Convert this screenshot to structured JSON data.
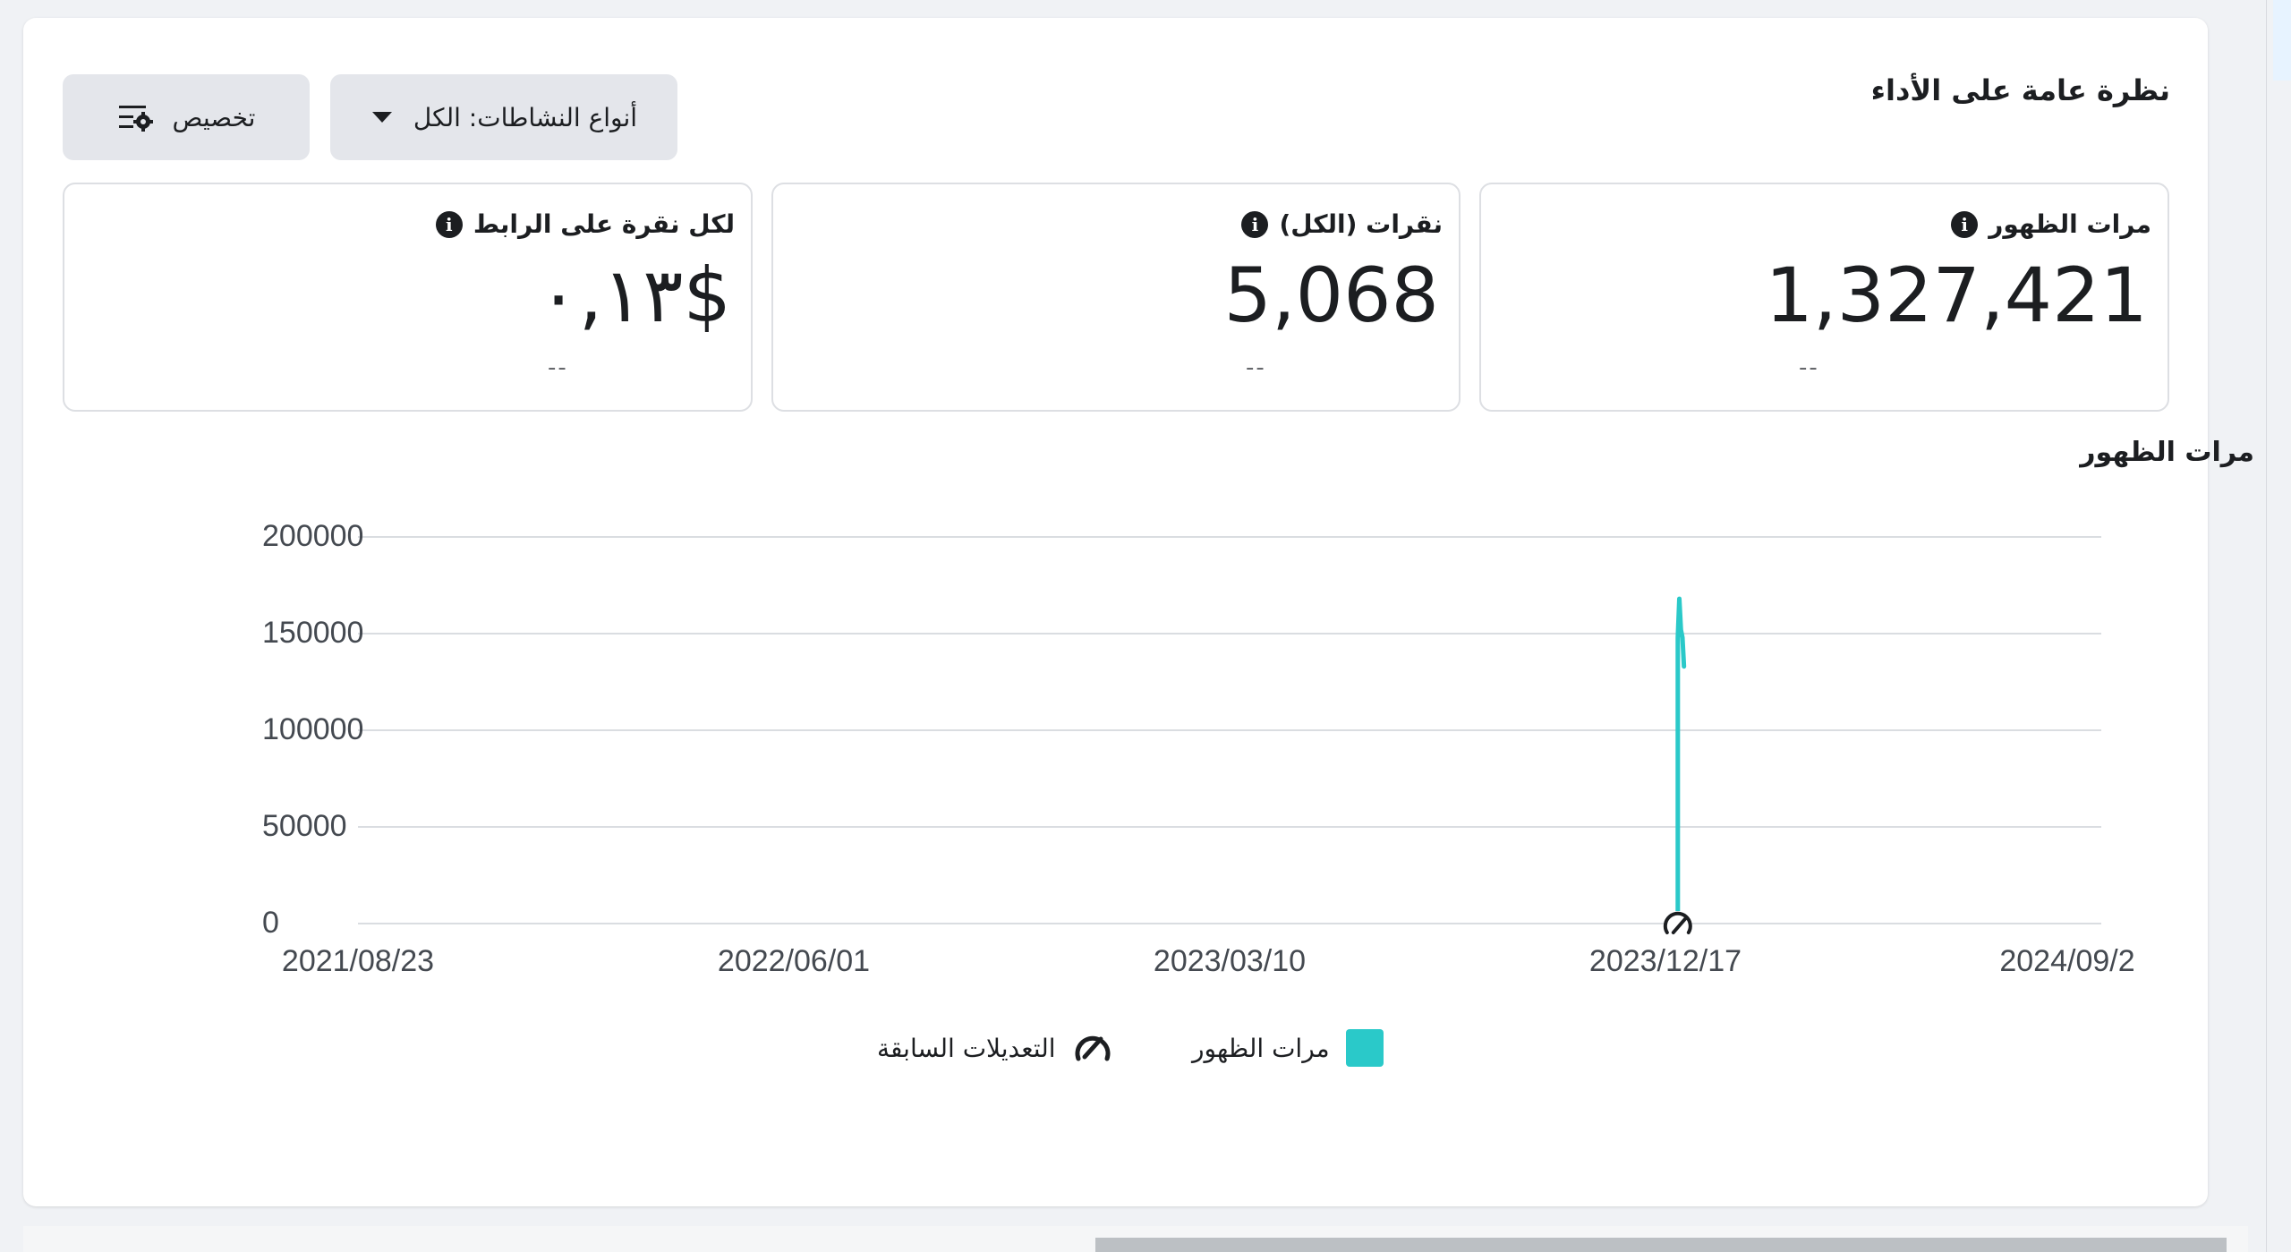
{
  "header": {
    "title": "نظرة عامة على الأداء",
    "customize_label": "تخصيص",
    "activity_types_label": "أنواع النشاطات: الكل"
  },
  "metrics": [
    {
      "label": "مرات الظهور",
      "value": "1,327,421",
      "delta": "--"
    },
    {
      "label": "نقرات (الكل)",
      "value": "5,068",
      "delta": "--"
    },
    {
      "label": "لكل نقرة على الرابط",
      "value": "٠,١٣$",
      "delta": "--"
    }
  ],
  "chart_section": {
    "title": "مرات الظهور"
  },
  "chart_data": {
    "type": "line",
    "x_ticks": [
      "2021/08/23",
      "2022/06/01",
      "2023/03/10",
      "2023/12/17",
      "2024/09/2"
    ],
    "y_ticks": [
      0,
      50000,
      100000,
      150000,
      200000
    ],
    "ylim": [
      0,
      200000
    ],
    "xlim": [
      "2021/08/23",
      "2024/09/24"
    ],
    "grid": true,
    "series": [
      {
        "name": "مرات الظهور",
        "color": "#2ac9c9",
        "points": [
          {
            "x": "2023/12/25",
            "y": 0
          },
          {
            "x": "2023/12/25",
            "y": 148000
          },
          {
            "x": "2023/12/26",
            "y": 168000
          },
          {
            "x": "2023/12/27",
            "y": 152000
          },
          {
            "x": "2023/12/28",
            "y": 148000
          },
          {
            "x": "2023/12/29",
            "y": 133000
          }
        ]
      }
    ],
    "annotations": [
      {
        "x": "2023/12/25",
        "icon": "previous-edits-icon"
      }
    ],
    "legend": [
      "مرات الظهور",
      "التعديلات السابقة"
    ],
    "legend_position": "bottom-center"
  },
  "legend": {
    "impressions_label": "مرات الظهور",
    "edits_label": "التعديلات السابقة"
  }
}
